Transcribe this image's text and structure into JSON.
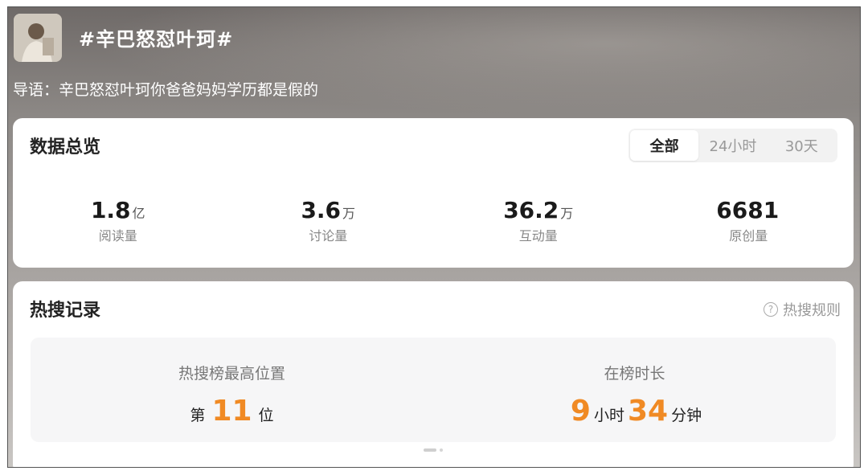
{
  "header": {
    "topic_title": "#辛巴怒怼叶珂#",
    "lead_text": "导语：辛巴怒怼叶珂你爸爸妈妈学历都是假的"
  },
  "overview": {
    "title": "数据总览",
    "tabs": [
      {
        "label": "全部",
        "active": true
      },
      {
        "label": "24小时",
        "active": false
      },
      {
        "label": "30天",
        "active": false
      }
    ],
    "stats": [
      {
        "value": "1.8",
        "unit": "亿",
        "label": "阅读量"
      },
      {
        "value": "3.6",
        "unit": "万",
        "label": "讨论量"
      },
      {
        "value": "36.2",
        "unit": "万",
        "label": "互动量"
      },
      {
        "value": "6681",
        "unit": "",
        "label": "原创量"
      }
    ]
  },
  "hot_record": {
    "title": "热搜记录",
    "rules_label": "热搜规则",
    "rules_icon": "question-circle-icon",
    "peak": {
      "label": "热搜榜最高位置",
      "prefix": "第",
      "value": "11",
      "suffix": "位"
    },
    "duration": {
      "label": "在榜时长",
      "hours": "9",
      "hours_unit": "小时",
      "minutes": "34",
      "minutes_unit": "分钟"
    }
  },
  "colors": {
    "accent_orange": "#f08a24",
    "card_bg": "#ffffff",
    "panel_bg": "#f6f6f7"
  }
}
